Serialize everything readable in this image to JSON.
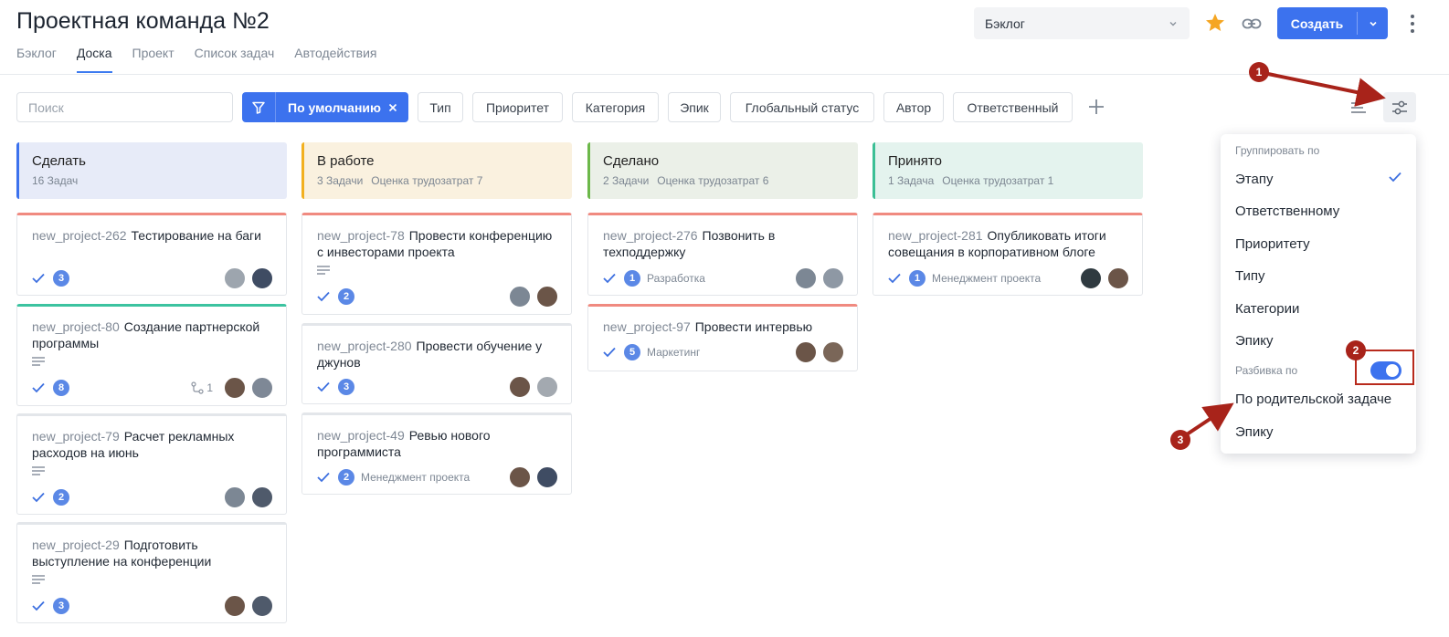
{
  "header": {
    "title": "Проектная команда №2",
    "tabs": [
      "Бэклог",
      "Доска",
      "Проект",
      "Список задач",
      "Автодействия"
    ],
    "active_tab": "Доска",
    "project_select": "Бэклог",
    "create_label": "Создать"
  },
  "filters": {
    "search_placeholder": "Поиск",
    "default_label": "По умолчанию",
    "buttons": [
      "Тип",
      "Приоритет",
      "Категория",
      "Эпик",
      "Глобальный статус",
      "Автор",
      "Ответственный"
    ]
  },
  "columns": [
    {
      "title": "Сделать",
      "count": "16 Задач",
      "estimate": "",
      "bg": "#e7ebf8",
      "accent": "#3c72ee"
    },
    {
      "title": "В работе",
      "count": "3 Задачи",
      "estimate": "Оценка трудозатрат 7",
      "bg": "#faf1df",
      "accent": "#f2b020"
    },
    {
      "title": "Сделано",
      "count": "2 Задачи",
      "estimate": "Оценка трудозатрат 6",
      "bg": "#ebf0e8",
      "accent": "#6cb84a"
    },
    {
      "title": "Принято",
      "count": "1 Задача",
      "estimate": "Оценка трудозатрат 1",
      "bg": "#e4f3ee",
      "accent": "#3cbf95"
    }
  ],
  "cards": {
    "c0": [
      {
        "key": "new_project-262",
        "title": "Тестирование на баги",
        "badge": "3",
        "tag": "",
        "subtasks": "",
        "priority_color": "#f08a80"
      },
      {
        "key": "new_project-80",
        "title": "Создание партнерской программы",
        "badge": "8",
        "tag": "",
        "subtasks": "1",
        "priority_color": "#3cc3a0"
      },
      {
        "key": "new_project-79",
        "title": "Расчет рекламных расходов на июнь",
        "badge": "2",
        "tag": "",
        "subtasks": "",
        "priority_color": "#e3e6ea"
      },
      {
        "key": "new_project-29",
        "title": "Подготовить выступление на конференции",
        "badge": "3",
        "tag": "",
        "subtasks": "",
        "priority_color": "#e3e6ea"
      }
    ],
    "c1": [
      {
        "key": "new_project-78",
        "title": "Провести конференцию с инвесторами проекта",
        "badge": "2",
        "tag": "",
        "priority_color": "#f08a80"
      },
      {
        "key": "new_project-280",
        "title": "Провести обучение у джунов",
        "badge": "3",
        "tag": "",
        "priority_color": "#e3e6ea"
      },
      {
        "key": "new_project-49",
        "title": "Ревью нового программиста",
        "badge": "2",
        "tag": "Менеджмент проекта",
        "priority_color": "#e3e6ea"
      }
    ],
    "c2": [
      {
        "key": "new_project-276",
        "title": "Позвонить в техподдержку",
        "badge": "1",
        "tag": "Разработка",
        "priority_color": "#f08a80"
      },
      {
        "key": "new_project-97",
        "title": "Провести интервью",
        "badge": "5",
        "tag": "Маркетинг",
        "priority_color": "#f08a80"
      }
    ],
    "c3": [
      {
        "key": "new_project-281",
        "title": "Опубликовать итоги совещания в корпоративном блоге",
        "badge": "1",
        "tag": "Менеджмент проекта",
        "priority_color": "#f08a80"
      }
    ]
  },
  "settings_menu": {
    "group_header": "Группировать по",
    "group_items": [
      "Этапу",
      "Ответственному",
      "Приоритету",
      "Типу",
      "Категории",
      "Эпику"
    ],
    "selected": "Этапу",
    "split_header": "Разбивка по",
    "split_enabled": true,
    "split_items": [
      "По родительской задаче",
      "Эпику"
    ]
  },
  "annotations": [
    "1",
    "2",
    "3"
  ],
  "colors": {
    "primary": "#3c72ee",
    "annotation": "#a8231a",
    "badge": "#5b88e6"
  }
}
